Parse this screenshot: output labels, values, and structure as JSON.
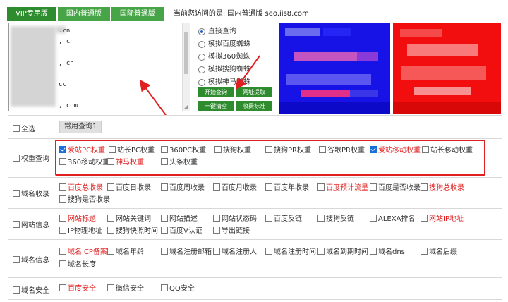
{
  "tabs": [
    {
      "label": "VIP专用版",
      "active": true
    },
    {
      "label": "国内普通版",
      "active": false
    },
    {
      "label": "国际普通版",
      "active": false
    }
  ],
  "visit_label": "当前您访问的是: 国内普通版 seo.iis8.com",
  "url_lines": [
    ".cn",
    ", cn",
    "",
    ", cn",
    "",
    "cc",
    "",
    ", com",
    "",
    "",
    ", com",
    ""
  ],
  "query_modes": [
    {
      "label": "直接查询",
      "selected": true
    },
    {
      "label": "模拟百度蜘蛛",
      "selected": false
    },
    {
      "label": "模拟360蜘蛛",
      "selected": false
    },
    {
      "label": "模拟搜狗蜘蛛",
      "selected": false
    },
    {
      "label": "模拟神马蜘蛛",
      "selected": false
    }
  ],
  "buttons": [
    "开始查询",
    "网址提取",
    "一键清空",
    "收费标准"
  ],
  "select_all_label": "全选",
  "common_query_label": "常用查询1",
  "categories": [
    {
      "label": "权重查询",
      "items": [
        {
          "label": "爱站PC权重",
          "checked": true,
          "red": true
        },
        {
          "label": "站长PC权重",
          "checked": false,
          "red": false
        },
        {
          "label": "360PC权重",
          "checked": false,
          "red": false
        },
        {
          "label": "搜狗权重",
          "checked": false,
          "red": false
        },
        {
          "label": "搜狗PR权重",
          "checked": false,
          "red": false
        },
        {
          "label": "谷歌PR权重",
          "checked": false,
          "red": false
        },
        {
          "label": "爱站移动权重",
          "checked": true,
          "red": true
        },
        {
          "label": "站长移动权重",
          "checked": false,
          "red": false
        },
        {
          "label": "360移动权重",
          "checked": false,
          "red": false
        },
        {
          "label": "神马权重",
          "checked": false,
          "red": true
        },
        {
          "label": "头条权重",
          "checked": false,
          "red": false
        }
      ]
    },
    {
      "label": "域名收录",
      "items": [
        {
          "label": "百度总收录",
          "checked": false,
          "red": true
        },
        {
          "label": "百度日收录",
          "checked": false,
          "red": false
        },
        {
          "label": "百度周收录",
          "checked": false,
          "red": false
        },
        {
          "label": "百度月收录",
          "checked": false,
          "red": false
        },
        {
          "label": "百度年收录",
          "checked": false,
          "red": false
        },
        {
          "label": "百度预计流量",
          "checked": false,
          "red": true
        },
        {
          "label": "百度是否收录",
          "checked": false,
          "red": false
        },
        {
          "label": "搜狗总收录",
          "checked": false,
          "red": true
        },
        {
          "label": "搜狗是否收录",
          "checked": false,
          "red": false
        }
      ]
    },
    {
      "label": "网站信息",
      "items": [
        {
          "label": "网站标题",
          "checked": false,
          "red": true
        },
        {
          "label": "网站关键词",
          "checked": false,
          "red": false
        },
        {
          "label": "网站描述",
          "checked": false,
          "red": false
        },
        {
          "label": "网站状态码",
          "checked": false,
          "red": false
        },
        {
          "label": "百度反链",
          "checked": false,
          "red": false
        },
        {
          "label": "搜狗反链",
          "checked": false,
          "red": false
        },
        {
          "label": "ALEXA排名",
          "checked": false,
          "red": false
        },
        {
          "label": "网站IP地址",
          "checked": false,
          "red": true
        },
        {
          "label": "IP物理地址",
          "checked": false,
          "red": false
        },
        {
          "label": "搜狗快照时间",
          "checked": false,
          "red": false
        },
        {
          "label": "百度V认证",
          "checked": false,
          "red": false
        },
        {
          "label": "导出链接",
          "checked": false,
          "red": false
        }
      ]
    },
    {
      "label": "域名信息",
      "items": [
        {
          "label": "域名ICP备案",
          "checked": false,
          "red": true
        },
        {
          "label": "域名年龄",
          "checked": false,
          "red": false
        },
        {
          "label": "域名注册邮箱",
          "checked": false,
          "red": false
        },
        {
          "label": "域名注册人",
          "checked": false,
          "red": false
        },
        {
          "label": "域名注册时间",
          "checked": false,
          "red": false
        },
        {
          "label": "域名到期时间",
          "checked": false,
          "red": false
        },
        {
          "label": "域名dns",
          "checked": false,
          "red": false
        },
        {
          "label": "域名后缀",
          "checked": false,
          "red": false
        },
        {
          "label": "域名长度",
          "checked": false,
          "red": false
        }
      ]
    },
    {
      "label": "域名安全",
      "items": [
        {
          "label": "百度安全",
          "checked": false,
          "red": true
        },
        {
          "label": "微信安全",
          "checked": false,
          "red": false
        },
        {
          "label": "QQ安全",
          "checked": false,
          "red": false
        }
      ]
    }
  ],
  "colors": {
    "green": "#47a447",
    "dark_green": "#2e8b2e",
    "highlight_red": "#e02020",
    "check_blue": "#1a6ed8"
  }
}
